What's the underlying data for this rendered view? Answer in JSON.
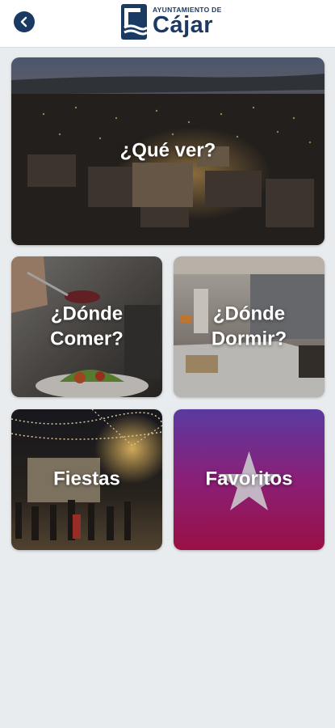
{
  "header": {
    "logo_small_text": "AYUNTAMIENTO DE",
    "logo_big_text": "Cájar",
    "back_icon": "arrow-left-icon"
  },
  "tiles": [
    {
      "label": "¿Qué ver?",
      "image": "town-at-dusk-photo"
    },
    {
      "label": "¿Dónde Comer?",
      "image": "food-plate-photo"
    },
    {
      "label": "¿Dónde Dormir?",
      "image": "hotel-room-photo"
    },
    {
      "label": "Fiestas",
      "image": "night-festival-photo"
    },
    {
      "label": "Favoritos",
      "icon": "star-icon"
    }
  ],
  "colors": {
    "brand": "#1b3a63",
    "background": "#e9ecee",
    "favoritos_gradient_top": "#5a3aa0",
    "favoritos_gradient_bottom": "#9a1045"
  }
}
